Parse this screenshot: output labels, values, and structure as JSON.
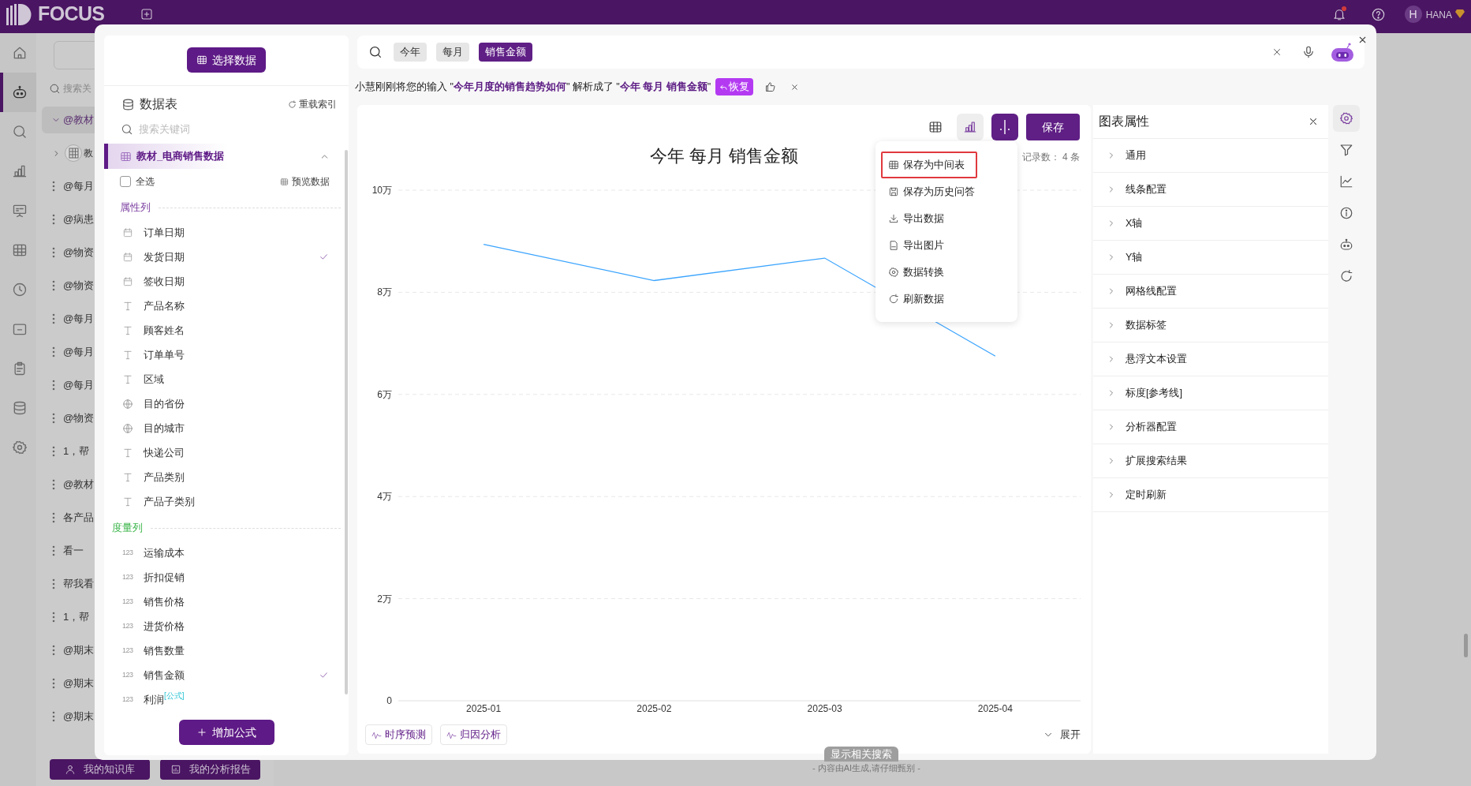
{
  "top_bar": {
    "logo": "FOCUS",
    "notification_dot": true,
    "user_initial": "H",
    "user_name": "HANA"
  },
  "nav_rail": [
    {
      "selected": false
    },
    {
      "selected": true
    },
    {
      "selected": false
    },
    {
      "selected": false
    },
    {
      "selected": false
    },
    {
      "selected": false
    },
    {
      "selected": false
    },
    {
      "selected": false
    },
    {
      "selected": false
    },
    {
      "selected": false
    },
    {
      "selected": false
    }
  ],
  "history": {
    "search_placeholder": "搜索关",
    "items": [
      {
        "kind": "group",
        "text": "@教材",
        "expanded": true
      },
      {
        "kind": "table",
        "text": "教"
      },
      {
        "kind": "chat",
        "text": "@每月"
      },
      {
        "kind": "chat",
        "text": "@病患"
      },
      {
        "kind": "chat",
        "text": "@物资"
      },
      {
        "kind": "chat",
        "text": "@物资"
      },
      {
        "kind": "chat",
        "text": "@每月"
      },
      {
        "kind": "chat",
        "text": "@每月"
      },
      {
        "kind": "chat",
        "text": "@每月"
      },
      {
        "kind": "chat",
        "text": "@物资"
      },
      {
        "kind": "chat",
        "text": "1，帮"
      },
      {
        "kind": "chat",
        "text": "@教材"
      },
      {
        "kind": "chat",
        "text": "各产品"
      },
      {
        "kind": "chat",
        "text": "看一"
      },
      {
        "kind": "chat",
        "text": "帮我看"
      },
      {
        "kind": "chat",
        "text": "1，帮"
      },
      {
        "kind": "chat",
        "text": "@期末"
      },
      {
        "kind": "chat",
        "text": "@期末"
      },
      {
        "kind": "chat",
        "text": "@期末"
      }
    ],
    "buttons": [
      "我的知识库",
      "我的分析报告"
    ]
  },
  "data_panel": {
    "select_button": "选择数据",
    "title": "数据表",
    "reload": "重载索引",
    "search_placeholder": "搜索关键词",
    "table": {
      "name": "教材_电商销售数据",
      "selected": true,
      "expanded": true
    },
    "select_all": {
      "label": "全选",
      "checked": false
    },
    "preview": "预览数据",
    "sections": [
      {
        "kind": "attribute",
        "title": "属性列",
        "fields": [
          {
            "kind": "date",
            "name": "订单日期",
            "checked": false
          },
          {
            "kind": "date",
            "name": "发货日期",
            "checked": true
          },
          {
            "kind": "date",
            "name": "签收日期",
            "checked": false
          },
          {
            "kind": "text",
            "name": "产品名称",
            "checked": false
          },
          {
            "kind": "text",
            "name": "顾客姓名",
            "checked": false
          },
          {
            "kind": "text",
            "name": "订单单号",
            "checked": false
          },
          {
            "kind": "text",
            "name": "区域",
            "checked": false
          },
          {
            "kind": "geo",
            "name": "目的省份",
            "checked": false
          },
          {
            "kind": "geo",
            "name": "目的城市",
            "checked": false
          },
          {
            "kind": "text",
            "name": "快递公司",
            "checked": false
          },
          {
            "kind": "text",
            "name": "产品类别",
            "checked": false
          },
          {
            "kind": "text",
            "name": "产品子类别",
            "checked": false
          }
        ]
      },
      {
        "kind": "measure",
        "title": "度量列",
        "fields": [
          {
            "kind": "number",
            "badge": "123",
            "name": "运输成本",
            "checked": false
          },
          {
            "kind": "number",
            "badge": "123",
            "name": "折扣促销",
            "checked": false
          },
          {
            "kind": "number",
            "badge": "123",
            "name": "销售价格",
            "checked": false
          },
          {
            "kind": "number",
            "badge": "123",
            "name": "进货价格",
            "checked": false
          },
          {
            "kind": "number",
            "badge": "123",
            "name": "销售数量",
            "checked": false
          },
          {
            "kind": "number",
            "badge": "123",
            "name": "销售金额",
            "checked": true
          },
          {
            "kind": "number",
            "badge": "123",
            "name": "利润",
            "tag": "[公式]",
            "checked": false
          }
        ]
      }
    ],
    "add_formula": "增加公式"
  },
  "search": {
    "tokens": [
      {
        "text": "今年",
        "selected": false
      },
      {
        "text": "每月",
        "selected": false
      },
      {
        "text": "销售金额",
        "selected": true
      }
    ]
  },
  "interpretation": {
    "text": "小慧刚刚将您的输入 \"**今年月度的销售趋势如何**\" 解析成了 \"**今年 每月 销售金额**\"",
    "restore": "恢复"
  },
  "chart_panel": {
    "views": [
      {
        "selected": false
      },
      {
        "selected": true
      }
    ],
    "more_open": true,
    "save": "保存",
    "title": "今年 每月 销售金额",
    "record_count": "记录数： 4 条",
    "menu": [
      {
        "label": "保存为中间表",
        "selected": true
      },
      {
        "label": "保存为历史问答",
        "selected": false
      },
      {
        "label": "导出数据",
        "selected": false
      },
      {
        "label": "导出图片",
        "selected": false
      },
      {
        "label": "数据转换",
        "selected": false
      },
      {
        "label": "刷新数据",
        "selected": false
      }
    ],
    "chart_data": {
      "type": "line",
      "categories": [
        "2025-01",
        "2025-02",
        "2025-03",
        "2025-04"
      ],
      "series": [
        {
          "color": "#3ba4ff",
          "values": [
            8.94,
            8.23,
            8.67,
            6.75
          ]
        }
      ],
      "ylim": [
        0,
        10
      ],
      "grid": true,
      "yticks": [
        {
          "value": 0,
          "label": "0"
        },
        {
          "value": 2,
          "label": "2万"
        },
        {
          "value": 4,
          "label": "4万"
        },
        {
          "value": 6,
          "label": "6万"
        },
        {
          "value": 8,
          "label": "8万"
        },
        {
          "value": 10,
          "label": "10万"
        }
      ]
    },
    "analysis_buttons": [
      "时序预测",
      "归因分析"
    ],
    "expand": "展开"
  },
  "properties": {
    "title": "图表属性",
    "items": [
      "通用",
      "线条配置",
      "X轴",
      "Y轴",
      "网格线配置",
      "数据标签",
      "悬浮文本设置",
      "标度[参考线]",
      "分析器配置",
      "扩展搜索结果",
      "定时刷新"
    ]
  },
  "side_tools": [
    {
      "selected": true
    },
    {
      "selected": false
    },
    {
      "selected": false
    },
    {
      "selected": false
    },
    {
      "selected": false
    },
    {
      "selected": false
    }
  ],
  "footer": {
    "related": "显示相关搜索",
    "disclaimer": "- 内容由AI生成,请仔细甄别 -"
  }
}
